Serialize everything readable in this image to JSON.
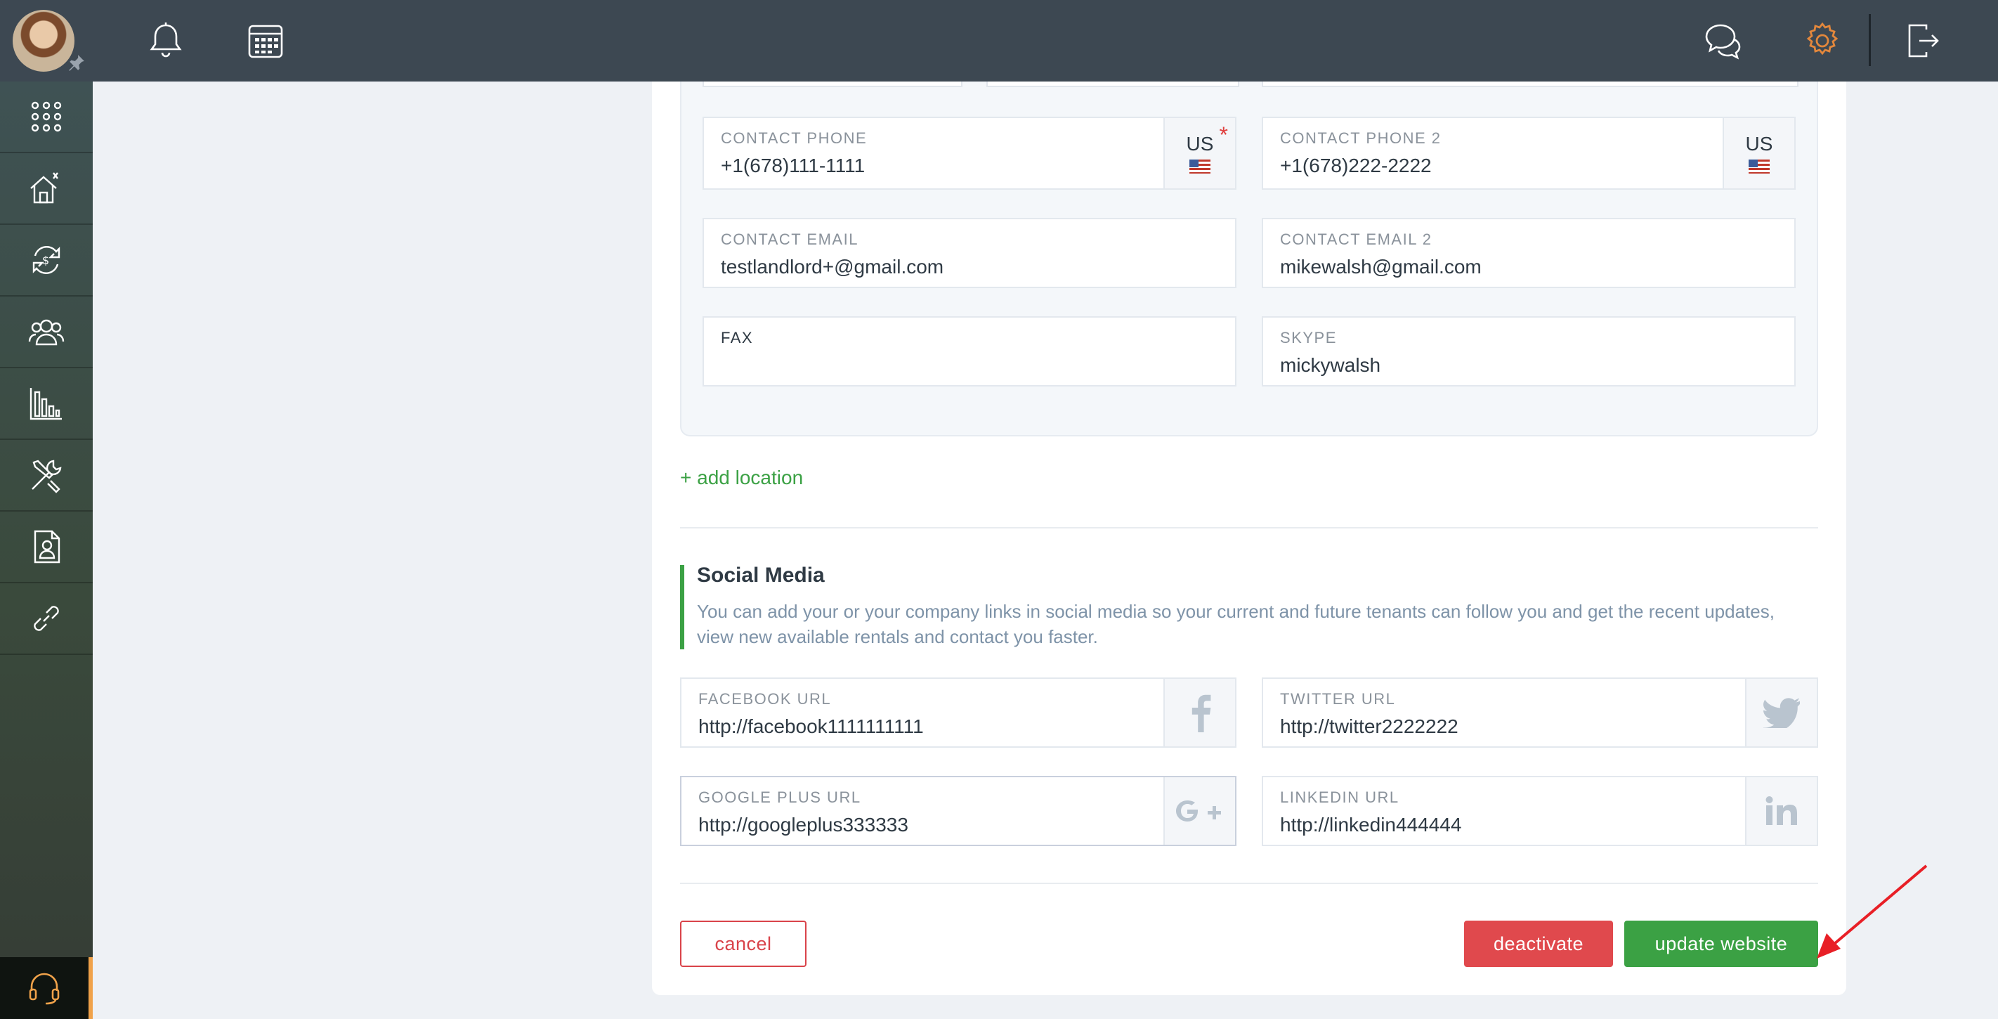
{
  "topbar": {
    "icons": [
      "bell-icon",
      "calendar-icon",
      "chat-icon",
      "gear-icon",
      "logout-icon"
    ],
    "accent_color": "#e2873c"
  },
  "sidebar": {
    "items": [
      "apps-grid-icon",
      "properties-icon",
      "payments-icon",
      "tenants-icon",
      "reports-icon",
      "maintenance-icon",
      "applications-icon",
      "links-icon"
    ],
    "support_icon": "headset-icon"
  },
  "contact": {
    "phone": {
      "label": "CONTACT PHONE",
      "value": "+1(678)111-1111",
      "country": "US",
      "required_mark": "*"
    },
    "phone2": {
      "label": "CONTACT PHONE 2",
      "value": "+1(678)222-2222",
      "country": "US"
    },
    "email": {
      "label": "CONTACT EMAIL",
      "value": "testlandlord+@gmail.com"
    },
    "email2": {
      "label": "CONTACT EMAIL 2",
      "value": "mikewalsh@gmail.com"
    },
    "fax": {
      "label": "FAX",
      "value": ""
    },
    "skype": {
      "label": "SKYPE",
      "value": "mickywalsh"
    }
  },
  "add_location": "+ add location",
  "social": {
    "title": "Social Media",
    "description": "You can add your or your company links in social media so your current and future tenants can follow you and get the recent updates, view new available rentals and contact you faster.",
    "facebook": {
      "label": "FACEBOOK URL",
      "value": "http://facebook1111111111",
      "icon": "facebook-icon"
    },
    "twitter": {
      "label": "TWITTER URL",
      "value": "http://twitter2222222",
      "icon": "twitter-icon"
    },
    "google": {
      "label": "GOOGLE PLUS URL",
      "value": "http://googleplus333333",
      "icon": "google-plus-icon"
    },
    "linkedin": {
      "label": "LINKEDIN URL",
      "value": "http://linkedin444444",
      "icon": "linkedin-icon"
    }
  },
  "actions": {
    "cancel": "cancel",
    "deactivate": "deactivate",
    "update": "update website"
  },
  "colors": {
    "green": "#3ba144",
    "red": "#e0494d",
    "topbar": "#3d4852"
  }
}
